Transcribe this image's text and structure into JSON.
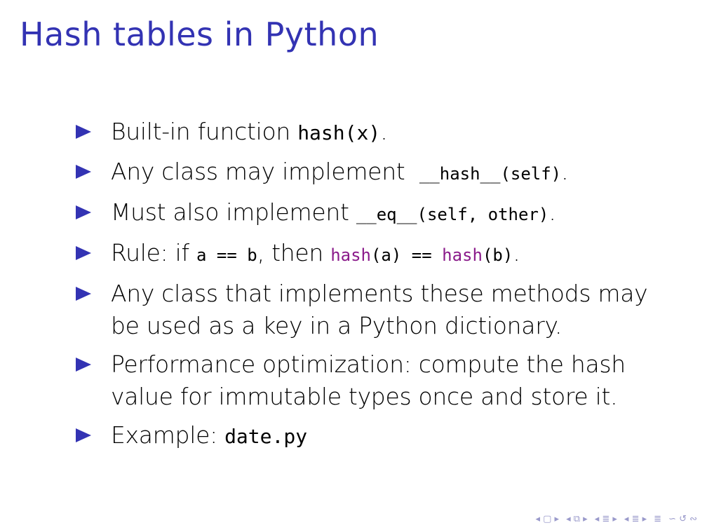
{
  "title": "Hash tables in Python",
  "accent_color": "#3333b3",
  "keyword_color": "#8a1a8a",
  "bullets": {
    "b1": {
      "text": "Built-in function ",
      "code": "hash(x)",
      "end": "."
    },
    "b2": {
      "text": "Any class may implement ",
      "code": "__hash__(self)",
      "end": "."
    },
    "b3": {
      "text": "Must also implement ",
      "code": "__eq__(self, other)",
      "end": "."
    },
    "b4": {
      "text1": "Rule: if ",
      "code1": "a == b",
      "text2": ", then ",
      "kw1": "hash",
      "code2": "(a) == ",
      "kw2": "hash",
      "code3": "(b)",
      "end": "."
    },
    "b5": {
      "text": "Any class that implements these methods may be used as a key in a Python dictionary."
    },
    "b6": {
      "text": "Performance optimization: compute the hash value for immutable types once and store it."
    },
    "b7": {
      "text": "Example: ",
      "code": "date.py"
    }
  },
  "navigation": {
    "items": [
      "◂ ▢ ▸",
      "◂ ⧉ ▸",
      "◂ ≣ ▸",
      "◂ ≣ ▸",
      "≣",
      "∽ ↺ ∾"
    ]
  }
}
